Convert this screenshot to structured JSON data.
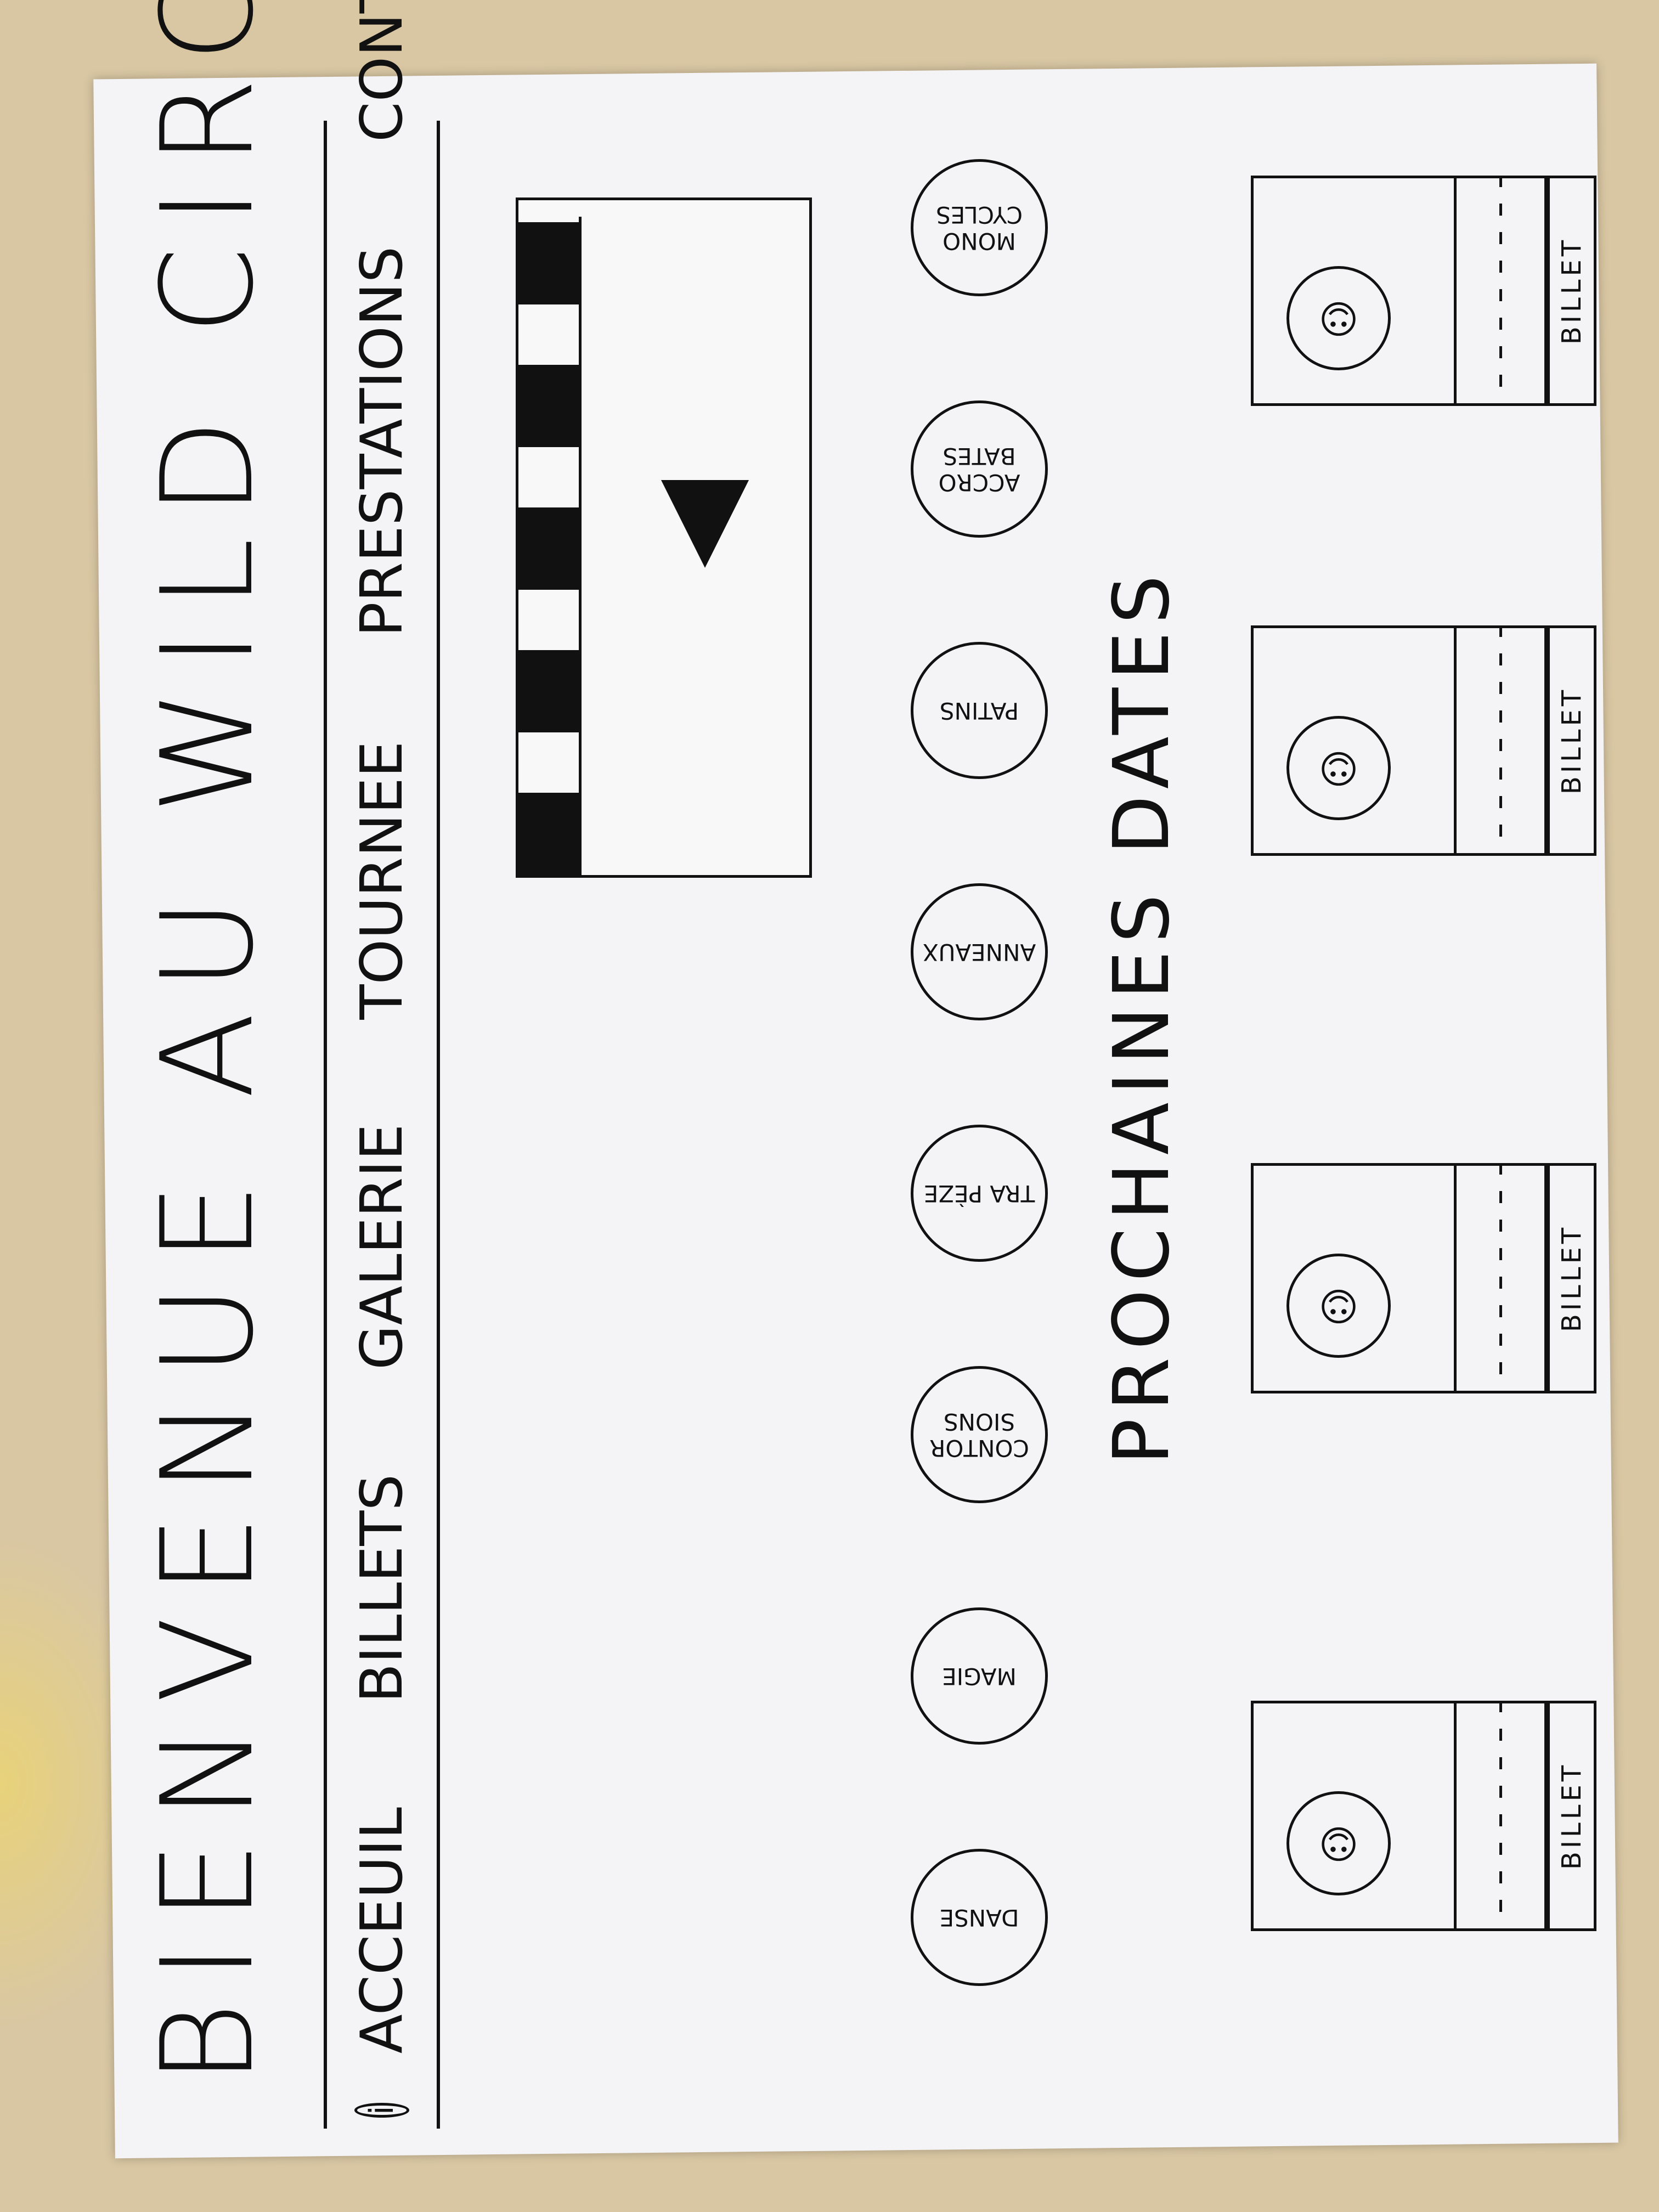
{
  "title": "BIENVENUE AU WILD CIRCUS",
  "nav": {
    "info_icon": "i",
    "items": [
      "ACCEUIL",
      "BILLETS",
      "GALERIE",
      "TOURNEE",
      "PRESTATIONS",
      "CONTACT"
    ]
  },
  "categories": [
    "DANSE",
    "MAGIE",
    "CONTOR SIONS",
    "TRA PÈZE",
    "ANNEAUX",
    "PATINS",
    "ACCRO BATES",
    "MONO CYCLES"
  ],
  "section_title": "PROCHAINES DATES",
  "cards": [
    {
      "face": "☺",
      "button": "BILLET"
    },
    {
      "face": "☺",
      "button": "BILLET"
    },
    {
      "face": "☺",
      "button": "BILLET"
    },
    {
      "face": "☺",
      "button": "BILLET"
    }
  ],
  "icons": {
    "info": "info-icon",
    "play": "play-icon",
    "face": "smiley-face-icon"
  }
}
